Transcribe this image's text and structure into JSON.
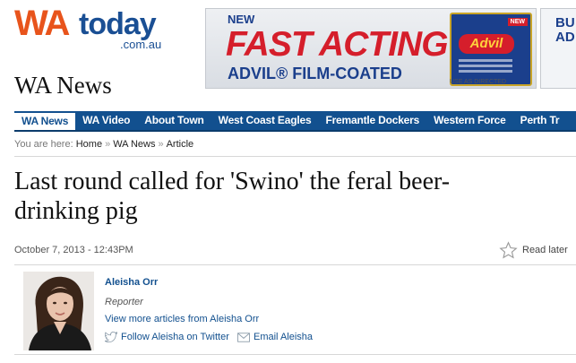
{
  "brand": {
    "logo_wa": "WA",
    "logo_today": "today",
    "logo_domain": ".com.au"
  },
  "ad": {
    "new_label": "NEW",
    "headline": "FAST ACTING",
    "subline": "ADVIL® FILM-COATED",
    "box_brand": "Advil",
    "box_new": "NEW",
    "caption": "USE AS DIRECTED",
    "side_text": "BU\nAD"
  },
  "section_title": "WA News",
  "nav": {
    "items": [
      {
        "label": "WA News",
        "active": true
      },
      {
        "label": "WA Video"
      },
      {
        "label": "About Town"
      },
      {
        "label": "West Coast Eagles"
      },
      {
        "label": "Fremantle Dockers"
      },
      {
        "label": "Western Force"
      },
      {
        "label": "Perth Tr"
      }
    ]
  },
  "breadcrumb": {
    "prefix": "You are here:",
    "items": [
      "Home",
      "WA News",
      "Article"
    ],
    "separator": "»"
  },
  "article": {
    "headline": "Last round called for 'Swino' the feral beer-drinking pig",
    "dateline": "October 7, 2013 - 12:43PM",
    "read_later": "Read later"
  },
  "author": {
    "name": "Aleisha Orr",
    "role": "Reporter",
    "more_link": "View more articles from Aleisha Orr",
    "follow_link": "Follow Aleisha on Twitter",
    "email_link": "Email Aleisha"
  },
  "colors": {
    "brand_orange": "#e8541c",
    "brand_blue": "#1a4f94",
    "nav_blue": "#12508f",
    "ad_red": "#d51e2b"
  }
}
